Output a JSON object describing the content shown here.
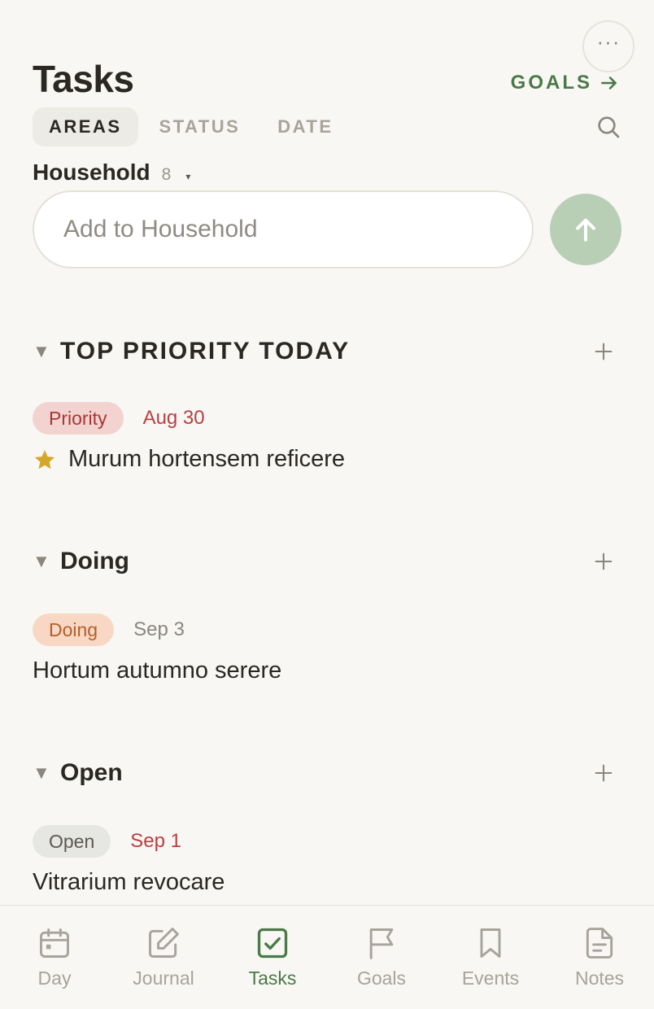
{
  "header": {
    "title": "Tasks",
    "goals_link": "GOALS",
    "more_icon": "ellipsis-icon"
  },
  "tabs": [
    {
      "label": "AREAS",
      "active": true
    },
    {
      "label": "STATUS",
      "active": false
    },
    {
      "label": "DATE",
      "active": false
    }
  ],
  "area": {
    "name": "Household",
    "count": "8",
    "caret": "▾"
  },
  "add_task": {
    "placeholder": "Add to Household",
    "value": ""
  },
  "sections": [
    {
      "title": "TOP PRIORITY TODAY",
      "tasks": [
        {
          "status": "Priority",
          "date": "Aug 30",
          "title": "Murum hortensem reficere",
          "starred": true
        }
      ]
    },
    {
      "title": "Doing",
      "tasks": [
        {
          "status": "Doing",
          "date": "Sep 3",
          "title": "Hortum autumno serere",
          "starred": false
        }
      ]
    },
    {
      "title": "Open",
      "tasks": [
        {
          "status": "Open",
          "date": "Sep 1",
          "title": "Vitrarium revocare",
          "starred": false
        }
      ]
    }
  ],
  "bottom_nav": [
    {
      "label": "Day",
      "icon": "calendar-icon"
    },
    {
      "label": "Journal",
      "icon": "edit-icon"
    },
    {
      "label": "Tasks",
      "icon": "checkbox-icon",
      "active": true
    },
    {
      "label": "Goals",
      "icon": "flag-icon"
    },
    {
      "label": "Events",
      "icon": "bookmark-icon"
    },
    {
      "label": "Notes",
      "icon": "document-icon"
    }
  ],
  "colors": {
    "accent": "#4a7a48",
    "background": "#f8f7f4",
    "overdue": "#b84040",
    "priority_badge": "#f2d3d0",
    "doing_badge": "#f8d8c4",
    "open_badge": "#e6e6e2",
    "send_button": "#b9cfb5",
    "star": "#d4a72c"
  }
}
